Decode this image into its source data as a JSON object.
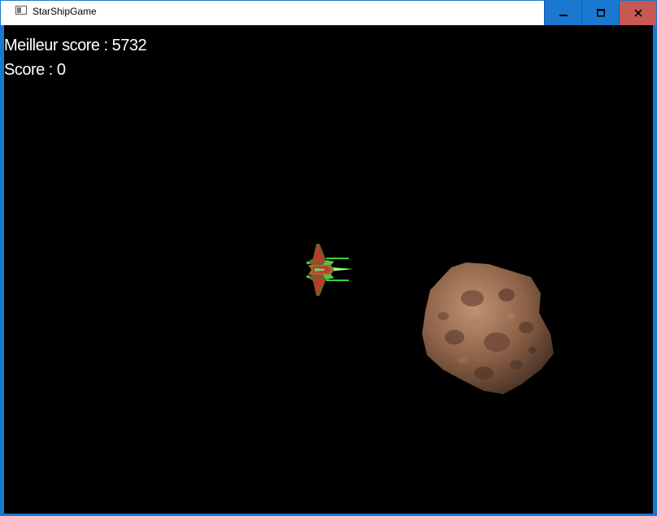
{
  "window": {
    "title": "StarShipGame",
    "controls": {
      "minimize": "minimize-icon",
      "maximize": "maximize-icon",
      "close": "close-icon"
    },
    "colors": {
      "titlebar_bg": "#ffffff",
      "controls_bg": "#1a78d0",
      "close_bg": "#c65a52",
      "border": "#1a78d0"
    }
  },
  "hud": {
    "best_score_label": "Meilleur score",
    "best_score_value": "5732",
    "score_label": "Score",
    "score_value": "0"
  },
  "scene": {
    "background": "#000000",
    "sprites": [
      "starship-sprite",
      "asteroid-sprite"
    ]
  }
}
